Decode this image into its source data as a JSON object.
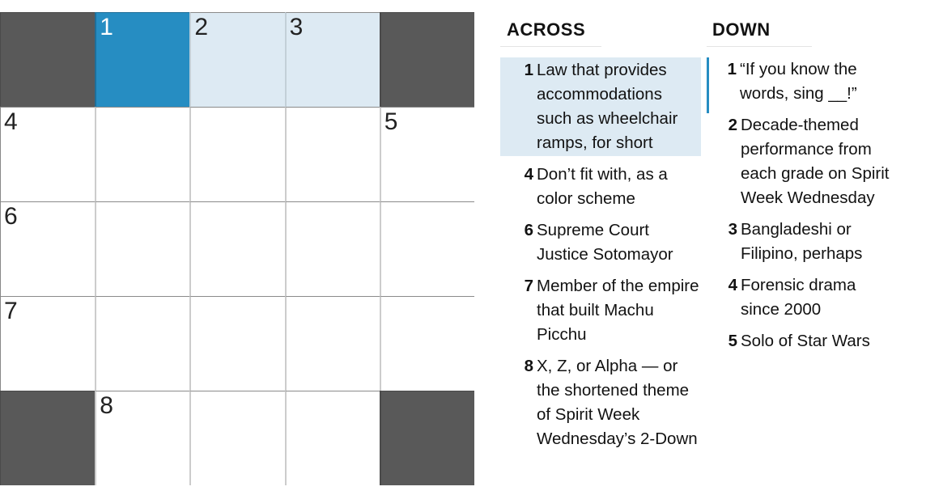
{
  "puzzle": {
    "rows": 5,
    "cols": 5,
    "colors": {
      "block": "#595959",
      "selected": "#268dc2",
      "highlight": "#ddeaf3",
      "empty": "#ffffff"
    },
    "cells": [
      {
        "r": 0,
        "c": 0,
        "type": "block"
      },
      {
        "r": 0,
        "c": 1,
        "type": "selected",
        "num": "1",
        "letter": ""
      },
      {
        "r": 0,
        "c": 2,
        "type": "highlight",
        "num": "2",
        "letter": ""
      },
      {
        "r": 0,
        "c": 3,
        "type": "highlight",
        "num": "3",
        "letter": ""
      },
      {
        "r": 0,
        "c": 4,
        "type": "block"
      },
      {
        "r": 1,
        "c": 0,
        "type": "empty",
        "num": "4",
        "letter": ""
      },
      {
        "r": 1,
        "c": 1,
        "type": "empty",
        "letter": ""
      },
      {
        "r": 1,
        "c": 2,
        "type": "empty",
        "letter": ""
      },
      {
        "r": 1,
        "c": 3,
        "type": "empty",
        "letter": ""
      },
      {
        "r": 1,
        "c": 4,
        "type": "empty",
        "num": "5",
        "letter": ""
      },
      {
        "r": 2,
        "c": 0,
        "type": "empty",
        "num": "6",
        "letter": ""
      },
      {
        "r": 2,
        "c": 1,
        "type": "empty",
        "letter": ""
      },
      {
        "r": 2,
        "c": 2,
        "type": "empty",
        "letter": ""
      },
      {
        "r": 2,
        "c": 3,
        "type": "empty",
        "letter": ""
      },
      {
        "r": 2,
        "c": 4,
        "type": "empty",
        "letter": ""
      },
      {
        "r": 3,
        "c": 0,
        "type": "empty",
        "num": "7",
        "letter": ""
      },
      {
        "r": 3,
        "c": 1,
        "type": "empty",
        "letter": ""
      },
      {
        "r": 3,
        "c": 2,
        "type": "empty",
        "letter": ""
      },
      {
        "r": 3,
        "c": 3,
        "type": "empty",
        "letter": ""
      },
      {
        "r": 3,
        "c": 4,
        "type": "empty",
        "letter": ""
      },
      {
        "r": 4,
        "c": 0,
        "type": "block"
      },
      {
        "r": 4,
        "c": 1,
        "type": "empty",
        "num": "8",
        "letter": ""
      },
      {
        "r": 4,
        "c": 2,
        "type": "empty",
        "letter": ""
      },
      {
        "r": 4,
        "c": 3,
        "type": "empty",
        "letter": ""
      },
      {
        "r": 4,
        "c": 4,
        "type": "block"
      }
    ]
  },
  "clues": {
    "across": {
      "heading": "ACROSS",
      "items": [
        {
          "num": "1",
          "text": "Law that provides accommodations such as wheelchair ramps, for short",
          "state": "active"
        },
        {
          "num": "4",
          "text": "Don’t fit with, as a color scheme",
          "state": ""
        },
        {
          "num": "6",
          "text": "Supreme Court Justice Sotomayor",
          "state": ""
        },
        {
          "num": "7",
          "text": "Member of the empire that built Machu Picchu",
          "state": ""
        },
        {
          "num": "8",
          "text": "X, Z, or Alpha — or the shortened theme of Spirit Week Wednesday’s 2-Down",
          "state": ""
        }
      ]
    },
    "down": {
      "heading": "DOWN",
      "items": [
        {
          "num": "1",
          "text": "“If you know the words, sing __!”",
          "state": "crossing"
        },
        {
          "num": "2",
          "text": "Decade-themed performance from each grade on Spirit Week Wednesday",
          "state": ""
        },
        {
          "num": "3",
          "text": "Bangladeshi or Filipino, perhaps",
          "state": ""
        },
        {
          "num": "4",
          "text": "Forensic drama since 2000",
          "state": ""
        },
        {
          "num": "5",
          "text": "Solo of Star Wars",
          "state": ""
        }
      ]
    }
  }
}
